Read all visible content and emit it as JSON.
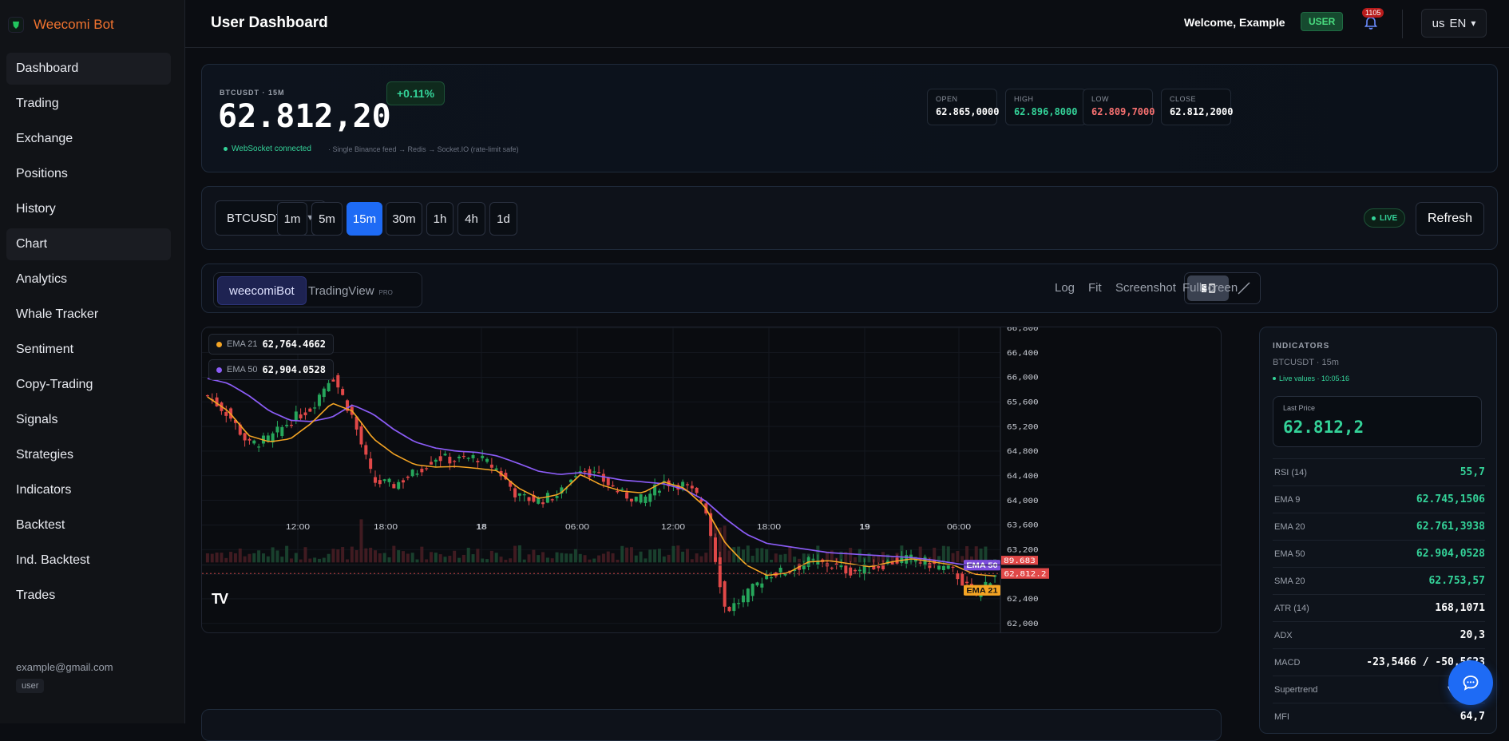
{
  "brand": {
    "name": "Weecomi Bot"
  },
  "sidebar": {
    "items": [
      {
        "label": "Dashboard"
      },
      {
        "label": "Trading"
      },
      {
        "label": "Exchange"
      },
      {
        "label": "Positions"
      },
      {
        "label": "History"
      },
      {
        "label": "Chart"
      },
      {
        "label": "Analytics"
      },
      {
        "label": "Whale Tracker"
      },
      {
        "label": "Sentiment"
      },
      {
        "label": "Copy-Trading"
      },
      {
        "label": "Signals"
      },
      {
        "label": "Strategies"
      },
      {
        "label": "Indicators"
      },
      {
        "label": "Backtest"
      },
      {
        "label": "Ind. Backtest"
      },
      {
        "label": "Trades"
      }
    ],
    "user_email": "example@gmail.com",
    "user_role": "user"
  },
  "header": {
    "title": "User Dashboard",
    "welcome": "Welcome, Example",
    "role_badge": "USER",
    "notification_count": "1105",
    "lang_flag": "us",
    "lang_code": "EN",
    "lang_caret": "▾"
  },
  "ticker": {
    "symbol_label": "BTCUSDT · 15M",
    "price": "62.812,20",
    "change": "+0.11%",
    "ws_status": "WebSocket connected",
    "ws_detail": "· Single Binance feed → Redis → Socket.IO (rate-limit safe)",
    "ohlc": [
      {
        "label": "OPEN",
        "value": "62.865,0000",
        "color": "#ffffff"
      },
      {
        "label": "HIGH",
        "value": "62.896,8000",
        "color": "#34d399"
      },
      {
        "label": "LOW",
        "value": "62.809,7000",
        "color": "#f87171"
      },
      {
        "label": "CLOSE",
        "value": "62.812,2000",
        "color": "#ffffff"
      }
    ]
  },
  "controls": {
    "symbol": "BTCUSDT",
    "symbol_caret": "▼",
    "timeframes": [
      "1m",
      "5m",
      "15m",
      "30m",
      "1h",
      "4h",
      "1d"
    ],
    "active_timeframe": "15m",
    "live_label": "LIVE",
    "refresh_label": "Refresh"
  },
  "sources": {
    "tabs": [
      "weecomiBot",
      "TradingView"
    ],
    "pro_badge": "PRO",
    "tools": [
      "Log",
      "Fit",
      "Screenshot",
      "Fullscreen"
    ]
  },
  "chart": {
    "legend": [
      {
        "name": "EMA 21",
        "value": "62,764.4662",
        "color": "#f5a524"
      },
      {
        "name": "EMA 50",
        "value": "62,904.0528",
        "color": "#8b5cf6"
      }
    ],
    "tv_logo": "TV",
    "price_tag_ema50": "EMA 50",
    "price_tag_ema21": "EMA 21",
    "price_tag_last": "62,812.2",
    "price_tag_volume": "89.683"
  },
  "chart_data": {
    "type": "candlestick",
    "symbol": "BTCUSDT",
    "interval": "15m",
    "y_ticks": [
      62000,
      62400,
      62800,
      63200,
      63600,
      64000,
      64400,
      64800,
      65200,
      65600,
      66000,
      66400,
      66800
    ],
    "y_tick_labels": [
      "62,000",
      "62,400",
      "62,800",
      "63,200",
      "63,600",
      "64,000",
      "64,400",
      "64,800",
      "65,200",
      "65,600",
      "66,000",
      "66,400",
      "66,800"
    ],
    "ylim": [
      61940,
      66810
    ],
    "x_ticks": [
      "12:00",
      "18:00",
      "18",
      "06:00",
      "12:00",
      "18:00",
      "19",
      "06:00"
    ],
    "last_price": 62812.2,
    "ema21_anchors": [
      65680,
      65450,
      65050,
      64950,
      65000,
      65250,
      65580,
      65450,
      65000,
      64750,
      64580,
      64540,
      64550,
      64520,
      64480,
      64200,
      64030,
      64100,
      64420,
      64250,
      64150,
      64120,
      64300,
      64200,
      63900,
      63300,
      62950,
      62780,
      62820,
      63000,
      63020,
      62970,
      62920,
      63000,
      63050,
      63000,
      62950,
      62800,
      62770
    ],
    "ema50_anchors": [
      65980,
      65900,
      65700,
      65450,
      65300,
      65280,
      65350,
      65550,
      65400,
      65150,
      64950,
      64850,
      64800,
      64780,
      64720,
      64600,
      64470,
      64420,
      64450,
      64390,
      64330,
      64300,
      64270,
      64180,
      64000,
      63700,
      63450,
      63300,
      63250,
      63200,
      63150,
      63130,
      63110,
      63090,
      63070,
      63030,
      62980,
      62930,
      62900
    ],
    "close_anchors": [
      65700,
      65400,
      64900,
      65000,
      65300,
      65500,
      66050,
      65350,
      64300,
      64250,
      64450,
      64700,
      64650,
      64700,
      64500,
      64050,
      64000,
      64100,
      64550,
      64350,
      64100,
      64000,
      64300,
      64250,
      63950,
      62200,
      62450,
      62800,
      62850,
      63000,
      62950,
      62850,
      62900,
      63000,
      63050,
      62950,
      62850,
      62450,
      62812
    ]
  },
  "indicators": {
    "title": "INDICATORS",
    "subtitle": "BTCUSDT · 15m",
    "live": "Live values · 10:05:16",
    "last_price_label": "Last Price",
    "last_price": "62.812,2",
    "rows": [
      {
        "k": "RSI (14)",
        "v": "55,7",
        "color": "#34d399"
      },
      {
        "k": "EMA 9",
        "v": "62.745,1506",
        "color": "#34d399"
      },
      {
        "k": "EMA 20",
        "v": "62.761,3938",
        "color": "#34d399"
      },
      {
        "k": "EMA 50",
        "v": "62.904,0528",
        "color": "#34d399"
      },
      {
        "k": "SMA 20",
        "v": "62.753,57",
        "color": "#34d399"
      },
      {
        "k": "ATR (14)",
        "v": "168,1071",
        "color": "#ffffff"
      },
      {
        "k": "ADX",
        "v": "20,3",
        "color": "#ffffff"
      },
      {
        "k": "MACD",
        "v": "-23,5466 / -50,5623",
        "color": "#ffffff"
      },
      {
        "k": "Supertrend",
        "v": "▼ 63.1",
        "color": "#ffffff"
      },
      {
        "k": "MFI",
        "v": "64,7",
        "color": "#ffffff"
      }
    ]
  }
}
